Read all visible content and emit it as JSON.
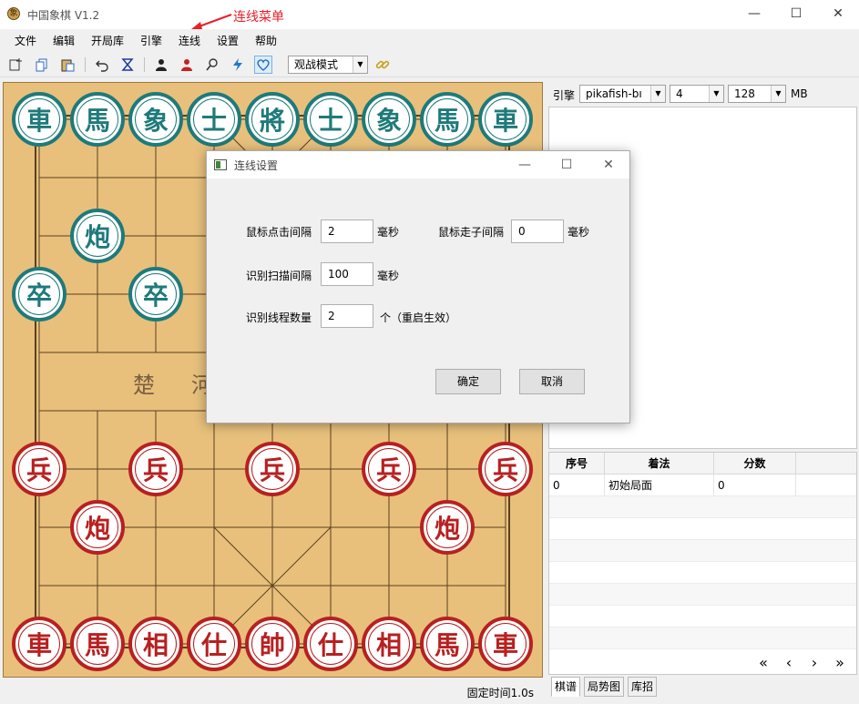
{
  "window": {
    "title": "中国象棋 V1.2",
    "app_icon": "象",
    "annotation": "连线菜单",
    "minimize": "—",
    "maximize": "☐",
    "close": "✕"
  },
  "menu": [
    "文件",
    "编辑",
    "开局库",
    "引擎",
    "连线",
    "设置",
    "帮助"
  ],
  "toolbar": {
    "mode_select": "观战模式",
    "icons": [
      "new-icon",
      "copy-icon",
      "paste-icon",
      "undo-icon",
      "hourglass-icon",
      "black-player-icon",
      "red-player-icon",
      "search-icon",
      "lightning-icon",
      "heart-icon",
      "link-icon"
    ]
  },
  "board": {
    "river_left": "楚",
    "river_right": "河",
    "black_pieces": [
      {
        "label": "車",
        "col": 0,
        "row": 0
      },
      {
        "label": "馬",
        "col": 1,
        "row": 0
      },
      {
        "label": "象",
        "col": 2,
        "row": 0
      },
      {
        "label": "士",
        "col": 3,
        "row": 0
      },
      {
        "label": "將",
        "col": 4,
        "row": 0
      },
      {
        "label": "士",
        "col": 5,
        "row": 0
      },
      {
        "label": "象",
        "col": 6,
        "row": 0
      },
      {
        "label": "馬",
        "col": 7,
        "row": 0
      },
      {
        "label": "車",
        "col": 8,
        "row": 0
      },
      {
        "label": "炮",
        "col": 1,
        "row": 2
      },
      {
        "label": "卒",
        "col": 0,
        "row": 3
      },
      {
        "label": "卒",
        "col": 2,
        "row": 3
      }
    ],
    "red_pieces": [
      {
        "label": "兵",
        "col": 0,
        "row": 6
      },
      {
        "label": "兵",
        "col": 2,
        "row": 6
      },
      {
        "label": "兵",
        "col": 4,
        "row": 6
      },
      {
        "label": "兵",
        "col": 6,
        "row": 6
      },
      {
        "label": "兵",
        "col": 8,
        "row": 6
      },
      {
        "label": "炮",
        "col": 1,
        "row": 7
      },
      {
        "label": "炮",
        "col": 7,
        "row": 7
      },
      {
        "label": "車",
        "col": 0,
        "row": 9
      },
      {
        "label": "馬",
        "col": 1,
        "row": 9
      },
      {
        "label": "相",
        "col": 2,
        "row": 9
      },
      {
        "label": "仕",
        "col": 3,
        "row": 9
      },
      {
        "label": "帥",
        "col": 4,
        "row": 9
      },
      {
        "label": "仕",
        "col": 5,
        "row": 9
      },
      {
        "label": "相",
        "col": 6,
        "row": 9
      },
      {
        "label": "馬",
        "col": 7,
        "row": 9
      },
      {
        "label": "車",
        "col": 8,
        "row": 9
      }
    ]
  },
  "status": {
    "time_text": "固定时间1.0s"
  },
  "engine_panel": {
    "label": "引擎",
    "engine_name": "pikafish-bı",
    "threads": "4",
    "hash": "128",
    "hash_unit": "MB"
  },
  "move_table": {
    "headers": [
      "序号",
      "着法",
      "分数"
    ],
    "rows": [
      {
        "index": "0",
        "move": "初始局面",
        "score": "0"
      }
    ]
  },
  "nav": {
    "first": "«",
    "prev": "‹",
    "next": "›",
    "last": "»"
  },
  "bottom_tabs": [
    "棋谱",
    "局势图",
    "库招"
  ],
  "dialog": {
    "title": "连线设置",
    "click_interval_label": "鼠标点击间隔",
    "click_interval_value": "2",
    "move_interval_label": "鼠标走子间隔",
    "move_interval_value": "0",
    "scan_interval_label": "识别扫描间隔",
    "scan_interval_value": "100",
    "threads_label": "识别线程数量",
    "threads_value": "2",
    "unit_ms": "毫秒",
    "threads_unit": "个（重启生效）",
    "ok": "确定",
    "cancel": "取消"
  }
}
